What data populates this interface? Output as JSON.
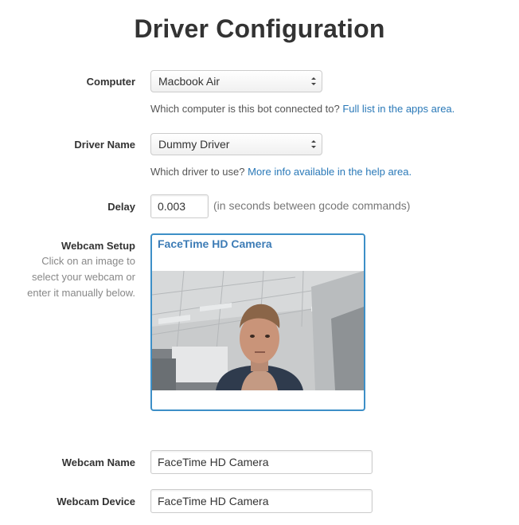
{
  "title": "Driver Configuration",
  "computer": {
    "label": "Computer",
    "value": "Macbook Air",
    "help_text": "Which computer is this bot connected to?",
    "help_link": "Full list in the apps area."
  },
  "driver": {
    "label": "Driver Name",
    "value": "Dummy Driver",
    "help_text": "Which driver to use?",
    "help_link": "More info available in the help area."
  },
  "delay": {
    "label": "Delay",
    "value": "0.003",
    "unit": "(in seconds between gcode commands)"
  },
  "webcam_setup": {
    "label": "Webcam Setup",
    "help_lines": [
      "Click on an image to",
      "select your webcam or",
      "enter it manually below."
    ],
    "camera_title": "FaceTime HD Camera"
  },
  "webcam_name": {
    "label": "Webcam Name",
    "value": "FaceTime HD Camera"
  },
  "webcam_device": {
    "label": "Webcam Device",
    "value": "FaceTime HD Camera"
  },
  "colors": {
    "link": "#2a79b8",
    "accent_border": "#3d8fc7"
  }
}
